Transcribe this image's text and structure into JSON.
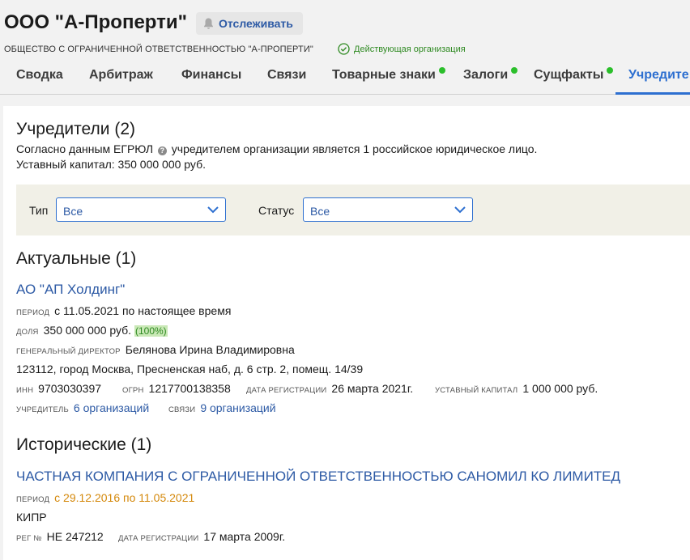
{
  "company": {
    "title": "ООО \"А-Проперти\"",
    "follow_label": "Отслеживать",
    "full_name": "ОБЩЕСТВО С ОГРАНИЧЕННОЙ ОТВЕТСТВЕННОСТЬЮ \"А-ПРОПЕРТИ\"",
    "status": "Действующая организация"
  },
  "tabs": [
    {
      "label": "Сводка"
    },
    {
      "label": "Арбитраж"
    },
    {
      "label": "Финансы"
    },
    {
      "label": "Связи"
    },
    {
      "label": "Товарные знаки",
      "dot": true
    },
    {
      "label": "Залоги",
      "dot": true
    },
    {
      "label": "Сущфакты",
      "dot": true
    },
    {
      "label": "Учредите",
      "active": true
    }
  ],
  "founders": {
    "title": "Учредители (2)",
    "desc_before": "Согласно данным ЕГРЮЛ",
    "desc_after": "учредителем организации является 1 российское юридическое лицо.",
    "capital": "Уставный капитал: 350 000 000 руб."
  },
  "filters": {
    "type_label": "Тип",
    "type_value": "Все",
    "status_label": "Статус",
    "status_value": "Все"
  },
  "current": {
    "title": "Актуальные (1)",
    "name": "АО \"АП Холдинг\"",
    "period_label": "ПЕРИОД",
    "period": "с 11.05.2021 по настоящее время",
    "share_label": "ДОЛЯ",
    "share": "350 000 000 руб.",
    "share_pct": "(100%)",
    "director_label": "ГЕНЕРАЛЬНЫЙ ДИРЕКТОР",
    "director": "Белянова Ирина Владимировна",
    "address": "123112, город Москва, Пресненская наб, д. 6 стр. 2, помещ. 14/39",
    "inn_label": "ИНН",
    "inn": "9703030397",
    "ogrn_label": "ОГРН",
    "ogrn": "1217700138358",
    "reg_label": "ДАТА РЕГИСТРАЦИИ",
    "reg_date": "26 марта 2021г.",
    "capital_label": "УСТАВНЫЙ КАПИТАЛ",
    "capital": "1 000 000 руб.",
    "founder_label": "УЧРЕДИТЕЛЬ",
    "founder_link": "6 организаций",
    "links_label": "СВЯЗИ",
    "links_link": "9 организаций"
  },
  "historical": {
    "title": "Исторические (1)",
    "name": "ЧАСТНАЯ КОМПАНИЯ С ОГРАНИЧЕННОЙ ОТВЕТСТВЕННОСТЬЮ САНОМИЛ КО ЛИМИТЕД",
    "period_label": "ПЕРИОД",
    "period": "с 29.12.2016 по 11.05.2021",
    "country": "КИПР",
    "reg_no_label": "РЕГ №",
    "reg_no": "НЕ 247212",
    "reg_label": "ДАТА РЕГИСТРАЦИИ",
    "reg_date": "17 марта 2009г."
  },
  "colors": {
    "link": "#2d5aa5",
    "accent": "#2d6fd0",
    "active_status": "#2f8a22",
    "dot": "#2bbf2b",
    "historical_period": "#d4880a"
  }
}
